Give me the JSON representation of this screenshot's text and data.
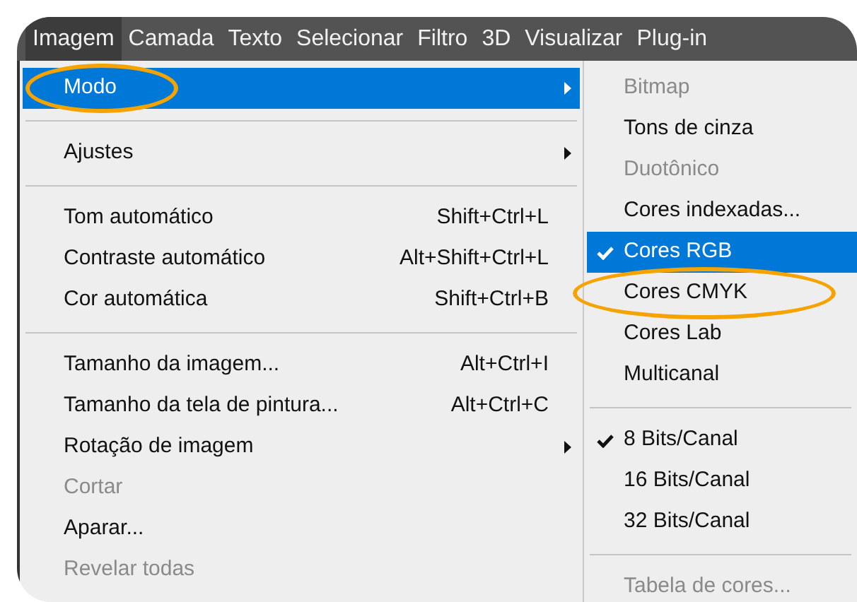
{
  "menubar": [
    {
      "label": "Imagem",
      "selected": true
    },
    {
      "label": "Camada",
      "selected": false
    },
    {
      "label": "Texto",
      "selected": false
    },
    {
      "label": "Selecionar",
      "selected": false
    },
    {
      "label": "Filtro",
      "selected": false
    },
    {
      "label": "3D",
      "selected": false
    },
    {
      "label": "Visualizar",
      "selected": false
    },
    {
      "label": "Plug-in",
      "selected": false
    }
  ],
  "menu": {
    "items": [
      {
        "kind": "item",
        "label": "Modo",
        "submenu": true,
        "selected": true,
        "annotated": true,
        "disabled": false
      },
      {
        "kind": "separator"
      },
      {
        "kind": "item",
        "label": "Ajustes",
        "submenu": true,
        "selected": false,
        "annotated": false,
        "disabled": false
      },
      {
        "kind": "separator"
      },
      {
        "kind": "item",
        "label": "Tom automático",
        "shortcut": "Shift+Ctrl+L",
        "submenu": false,
        "selected": false,
        "annotated": false,
        "disabled": false
      },
      {
        "kind": "item",
        "label": "Contraste automático",
        "shortcut": "Alt+Shift+Ctrl+L",
        "submenu": false,
        "selected": false,
        "annotated": false,
        "disabled": false
      },
      {
        "kind": "item",
        "label": "Cor automática",
        "shortcut": "Shift+Ctrl+B",
        "submenu": false,
        "selected": false,
        "annotated": false,
        "disabled": false
      },
      {
        "kind": "separator"
      },
      {
        "kind": "item",
        "label": "Tamanho da imagem...",
        "shortcut": "Alt+Ctrl+I",
        "submenu": false,
        "selected": false,
        "annotated": false,
        "disabled": false
      },
      {
        "kind": "item",
        "label": "Tamanho da tela de pintura...",
        "shortcut": "Alt+Ctrl+C",
        "submenu": false,
        "selected": false,
        "annotated": false,
        "disabled": false
      },
      {
        "kind": "item",
        "label": "Rotação de imagem",
        "submenu": true,
        "selected": false,
        "annotated": false,
        "disabled": false
      },
      {
        "kind": "item",
        "label": "Cortar",
        "submenu": false,
        "selected": false,
        "annotated": false,
        "disabled": true
      },
      {
        "kind": "item",
        "label": "Aparar...",
        "submenu": false,
        "selected": false,
        "annotated": false,
        "disabled": false
      },
      {
        "kind": "item",
        "label": "Revelar todas",
        "submenu": false,
        "selected": false,
        "annotated": false,
        "disabled": true
      }
    ]
  },
  "submenu": {
    "items": [
      {
        "kind": "item",
        "label": "Bitmap",
        "checked": false,
        "disabled": true,
        "selected": false,
        "annotated": false
      },
      {
        "kind": "item",
        "label": "Tons de cinza",
        "checked": false,
        "disabled": false,
        "selected": false,
        "annotated": false
      },
      {
        "kind": "item",
        "label": "Duotônico",
        "checked": false,
        "disabled": true,
        "selected": false,
        "annotated": false
      },
      {
        "kind": "item",
        "label": "Cores indexadas...",
        "checked": false,
        "disabled": false,
        "selected": false,
        "annotated": false
      },
      {
        "kind": "item",
        "label": "Cores RGB",
        "checked": true,
        "disabled": false,
        "selected": true,
        "annotated": false
      },
      {
        "kind": "item",
        "label": "Cores CMYK",
        "checked": false,
        "disabled": false,
        "selected": false,
        "annotated": true
      },
      {
        "kind": "item",
        "label": "Cores Lab",
        "checked": false,
        "disabled": false,
        "selected": false,
        "annotated": false
      },
      {
        "kind": "item",
        "label": "Multicanal",
        "checked": false,
        "disabled": false,
        "selected": false,
        "annotated": false
      },
      {
        "kind": "separator"
      },
      {
        "kind": "item",
        "label": "8 Bits/Canal",
        "checked": true,
        "disabled": false,
        "selected": false,
        "annotated": false
      },
      {
        "kind": "item",
        "label": "16 Bits/Canal",
        "checked": false,
        "disabled": false,
        "selected": false,
        "annotated": false
      },
      {
        "kind": "item",
        "label": "32 Bits/Canal",
        "checked": false,
        "disabled": false,
        "selected": false,
        "annotated": false
      },
      {
        "kind": "separator"
      },
      {
        "kind": "item",
        "label": "Tabela de cores...",
        "checked": false,
        "disabled": true,
        "selected": false,
        "annotated": false
      }
    ]
  }
}
